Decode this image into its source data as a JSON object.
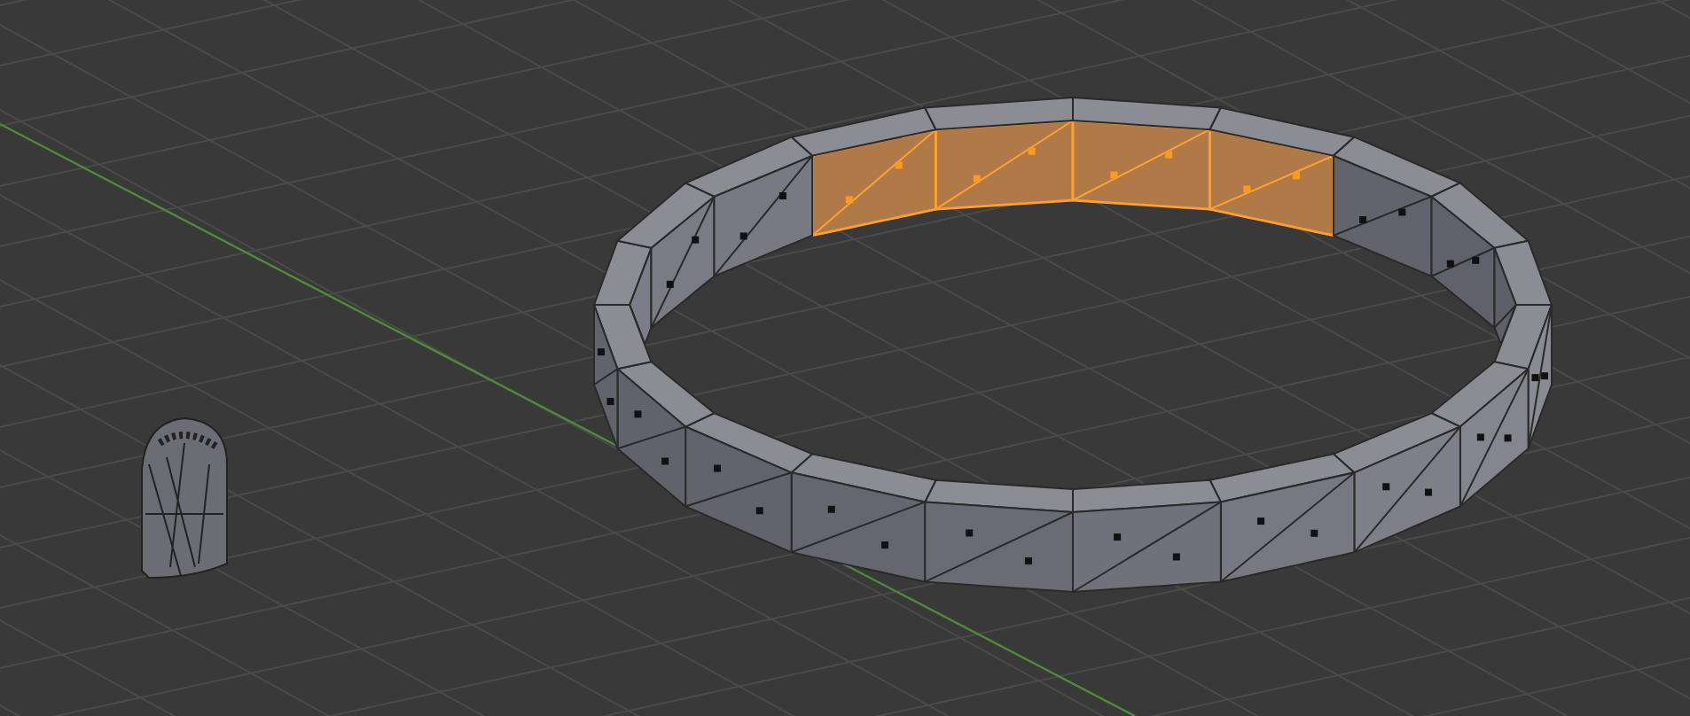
{
  "viewport": {
    "ring": {
      "faces": [
        {
          "selected": true
        },
        {
          "selected": true
        },
        {
          "selected": true
        },
        {
          "selected": true
        },
        {
          "selected": false
        },
        {
          "selected": false
        },
        {
          "selected": false
        },
        {
          "selected": false
        },
        {
          "selected": false
        },
        {
          "selected": false
        },
        {
          "selected": false
        },
        {
          "selected": false
        },
        {
          "selected": false
        },
        {
          "selected": false
        },
        {
          "selected": false
        },
        {
          "selected": false
        },
        {
          "selected": false
        },
        {
          "selected": false
        },
        {
          "selected": false
        },
        {
          "selected": false
        }
      ]
    }
  }
}
